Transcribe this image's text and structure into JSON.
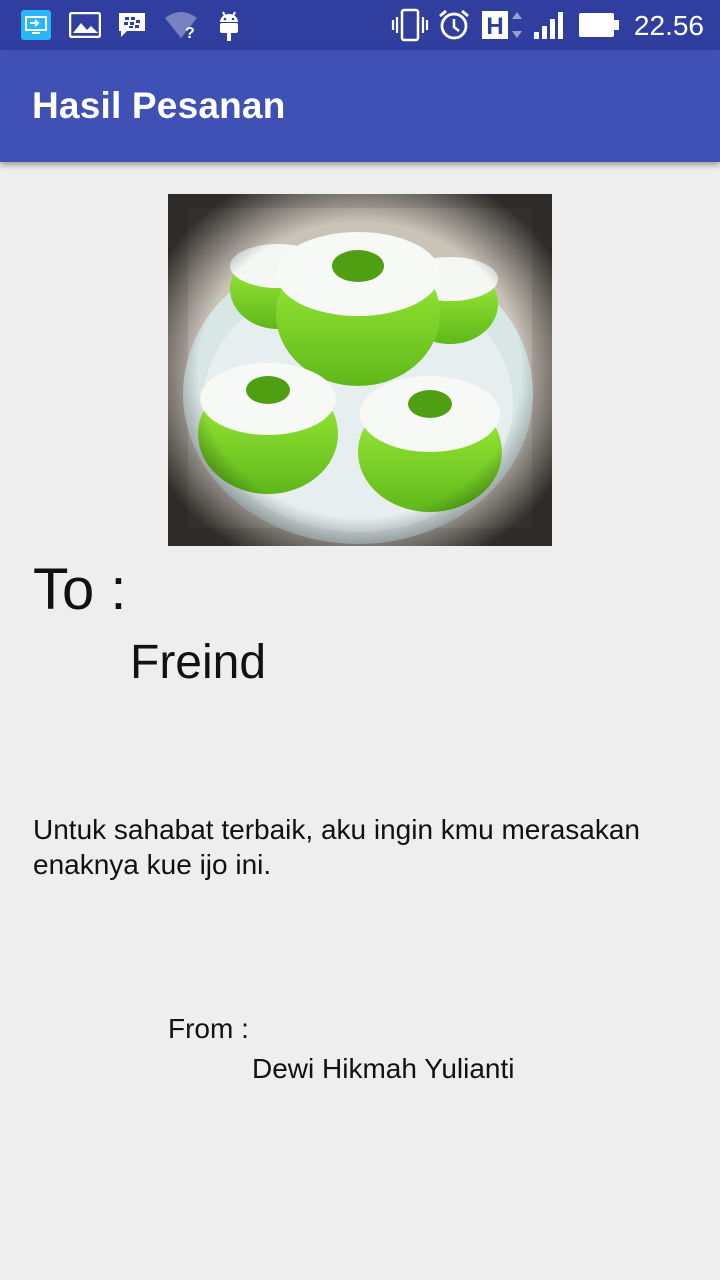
{
  "status_bar": {
    "time": "22.56",
    "network_type": "H",
    "icons": [
      "screen-cast-icon",
      "gallery-icon",
      "bbm-icon",
      "wifi-question-icon",
      "android-debug-icon",
      "vibrate-icon",
      "alarm-icon",
      "network-h-icon",
      "signal-icon",
      "battery-icon"
    ]
  },
  "app_bar": {
    "title": "Hasil Pesanan"
  },
  "card": {
    "image": "kue-ijo-photo",
    "to_label": "To :",
    "to_name": "Freind",
    "message": "Untuk sahabat terbaik, aku ingin kmu merasakan enaknya kue ijo ini.",
    "from_label": "From :",
    "from_name": "Dewi Hikmah Yulianti"
  },
  "colors": {
    "status_bar": "#303f9f",
    "app_bar": "#3f51b5",
    "background": "#eeeeee",
    "cake_green": "#7ed321"
  }
}
